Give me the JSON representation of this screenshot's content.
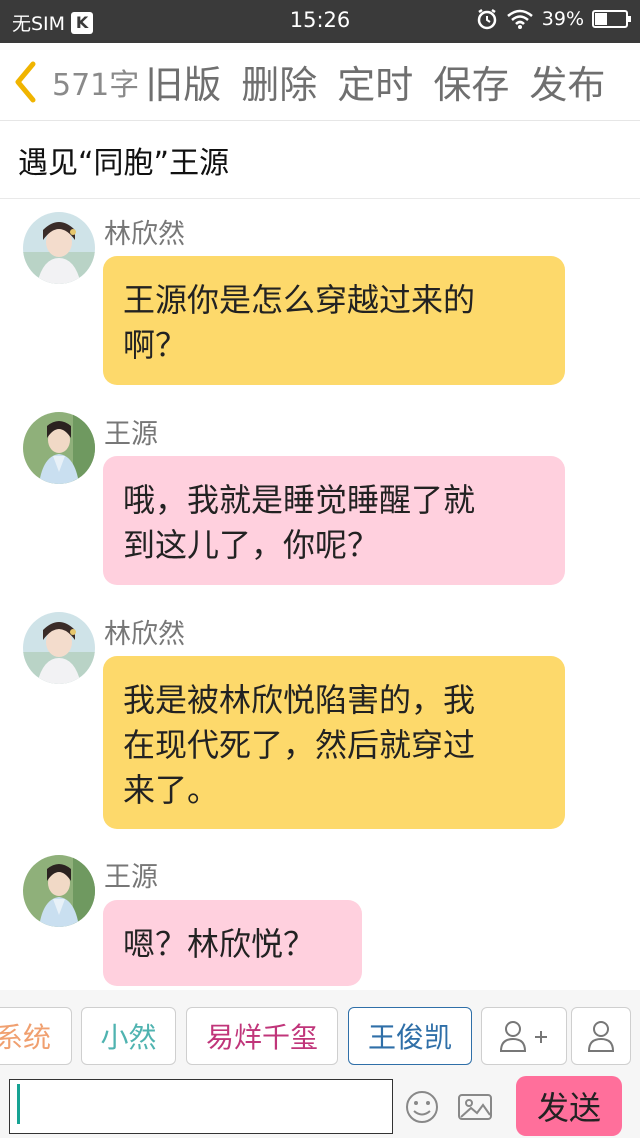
{
  "status_bar": {
    "carrier": "无SIM",
    "time": "15:26",
    "battery_percent": "39%",
    "battery_level": 0.39,
    "icons": [
      "k-icon",
      "alarm-icon",
      "wifi-icon",
      "battery-icon"
    ]
  },
  "toolbar": {
    "word_count": "571字",
    "old_version": "旧版",
    "delete": "删除",
    "timer": "定时",
    "save": "保存",
    "publish": "发布"
  },
  "story": {
    "title": "遇见“同胞”王源"
  },
  "messages": [
    {
      "sender": "林欣然",
      "text": "王源你是怎么穿越过来的啊？",
      "lines": [
        "王源你是怎么穿越过来的",
        "啊？"
      ],
      "style": "yellow"
    },
    {
      "sender": "王源",
      "text": "哦，我就是睡觉睡醒了就到这儿了，你呢？",
      "lines": [
        "哦，我就是睡觉睡醒了就",
        "到这儿了，你呢？"
      ],
      "style": "pink"
    },
    {
      "sender": "林欣然",
      "text": "我是被林欣悦陷害的，我在现代死了，然后就穿过来了。",
      "lines": [
        "我是被林欣悦陷害的，我",
        "在现代死了，然后就穿过",
        "来了。"
      ],
      "style": "yellow"
    },
    {
      "sender": "王源",
      "text": "嗯？林欣悦？",
      "lines": [
        "嗯？林欣悦？"
      ],
      "style": "pink"
    }
  ],
  "characters": [
    {
      "label": "系统",
      "color": "#f0a070"
    },
    {
      "label": "小然",
      "color": "#4fb3b0"
    },
    {
      "label": "易烊千玺",
      "color": "#c0357a"
    },
    {
      "label": "王俊凯",
      "color": "#2f6fa8",
      "selected": true
    }
  ],
  "input": {
    "placeholder": "",
    "value": "",
    "send_label": "发送"
  },
  "colors": {
    "yellow_bubble": "#fdd96b",
    "pink_bubble": "#ffd0de",
    "send_button": "#ff6f9b",
    "back_chevron": "#f0b400"
  }
}
